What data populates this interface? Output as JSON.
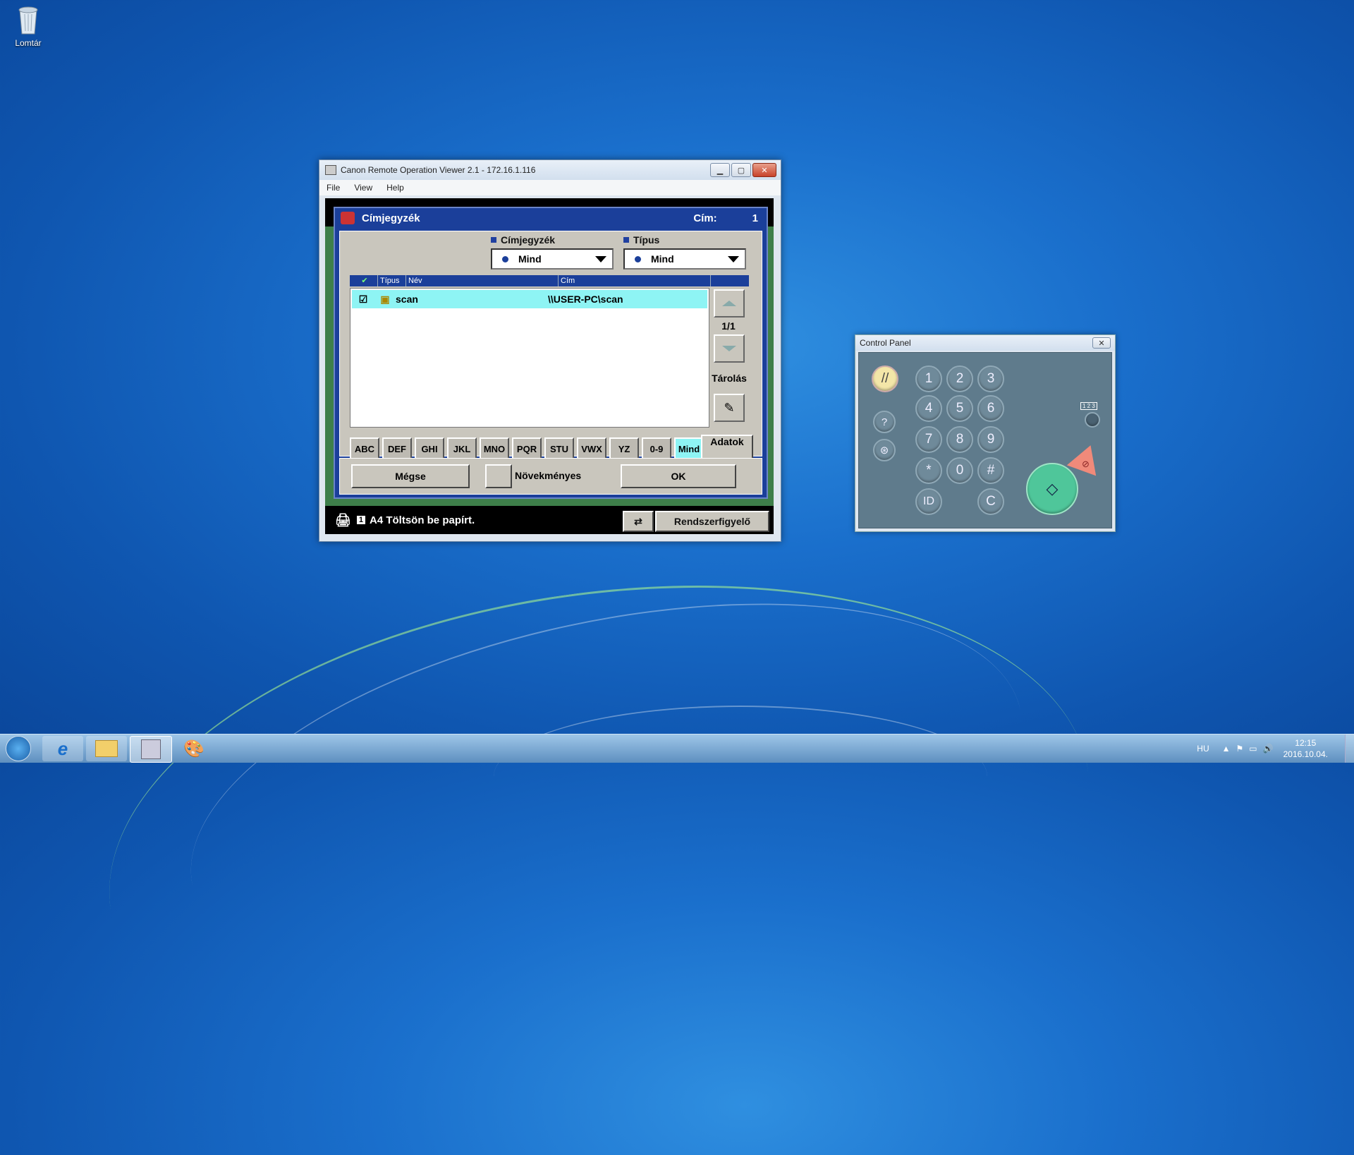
{
  "desktop": {
    "recycle_bin_label": "Lomtár"
  },
  "window": {
    "title": "Canon Remote Operation Viewer 2.1 - 172.16.1.116",
    "menu": [
      "File",
      "View",
      "Help"
    ]
  },
  "panel": {
    "title": "Címjegyzék",
    "cim_label": "Cím:",
    "cim_value": "1",
    "addressbook_label": "Címjegyzék",
    "addressbook_value": "Mind",
    "type_label": "Típus",
    "type_value": "Mind",
    "columns": [
      "Típus",
      "Név",
      "Cím"
    ],
    "rows": [
      {
        "name": "scan",
        "address": "\\\\USER-PC\\scan"
      }
    ],
    "page": "1/1",
    "store_label": "Tárolás",
    "keys": [
      "ABC",
      "DEF",
      "GHI",
      "JKL",
      "MNO",
      "PQR",
      "STU",
      "VWX",
      "YZ",
      "0-9",
      "Mind"
    ],
    "details_label": "Adatok",
    "cancel_label": "Mégse",
    "incremental_label": "Növekményes",
    "ok_label": "OK"
  },
  "status": {
    "tray_number": "1",
    "message": "A4 Töltsön be papírt.",
    "monitor_label": "Rendszerfigyelő"
  },
  "control_panel": {
    "title": "Control Panel",
    "keypad": [
      "1",
      "2",
      "3",
      "4",
      "5",
      "6",
      "7",
      "8",
      "9",
      "*",
      "0",
      "#"
    ],
    "id_label": "ID",
    "clear_label": "C",
    "help_label": "?",
    "counter_label": "1 2 3"
  },
  "taskbar": {
    "language": "HU",
    "time": "12:15",
    "date": "2016.10.04."
  },
  "colors": {
    "accent": "#1b3f9a",
    "selected_row": "#8ef4f4",
    "start_button": "#4fc69a",
    "stop_button": "#f08a7a"
  }
}
